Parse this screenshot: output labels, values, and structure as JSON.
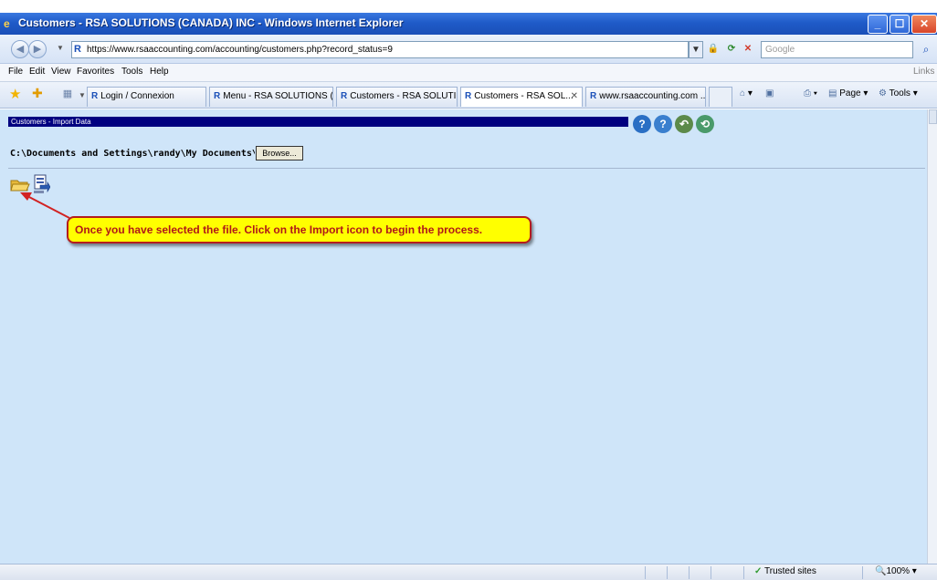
{
  "window": {
    "title": "Customers - RSA SOLUTIONS (CANADA) INC - Windows Internet Explorer",
    "controls": {
      "minimize": "_",
      "maximize": "☐",
      "close": "✕"
    }
  },
  "address_bar": {
    "url": "https://www.rsaaccounting.com/accounting/customers.php?record_status=9",
    "search_placeholder": "Google"
  },
  "menu": [
    "File",
    "Edit",
    "View",
    "Favorites",
    "Tools",
    "Help"
  ],
  "links_label": "Links",
  "tabs": [
    {
      "label": "Login / Connexion",
      "active": false
    },
    {
      "label": "Menu - RSA SOLUTIONS (...",
      "active": false
    },
    {
      "label": "Customers - RSA SOLUTI...",
      "active": false
    },
    {
      "label": "Customers - RSA SOL...",
      "active": true
    },
    {
      "label": "www.rsaaccounting.com ...",
      "active": false
    }
  ],
  "command_bar": {
    "page": "Page",
    "tools": "Tools"
  },
  "page": {
    "header_title": "Customers - Import Data",
    "file_path": "C:\\Documents and Settings\\randy\\My Documents\\",
    "browse_label": "Browse...",
    "callout_text": "Once you have selected the file. Click on the Import icon to begin the process."
  },
  "status_bar": {
    "zone": "Trusted sites",
    "zoom": "100%"
  },
  "colors": {
    "content_bg": "#cfe5f9",
    "header_bar": "#000080",
    "callout_bg": "#ffff00",
    "callout_border": "#b41d1d",
    "callout_text": "#b01818"
  }
}
